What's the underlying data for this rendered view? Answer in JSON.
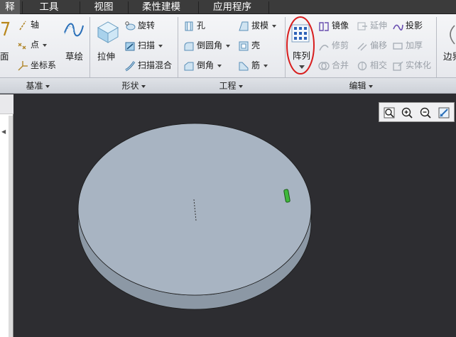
{
  "menu": {
    "tabs": [
      {
        "label": "释",
        "active": true
      },
      {
        "label": "工具",
        "active": false
      },
      {
        "label": "视图",
        "active": false
      },
      {
        "label": "柔性建模",
        "active": false
      },
      {
        "label": "应用程序",
        "active": false
      }
    ]
  },
  "groups": {
    "datum": {
      "label": "基准",
      "axis": "轴",
      "point": "点",
      "csys": "坐标系",
      "plane_partial": "面",
      "sketch": "草绘"
    },
    "shapes": {
      "label": "形状",
      "extrude": "拉伸",
      "revolve": "旋转",
      "sweep": "扫描",
      "swept_blend": "扫描混合"
    },
    "engineering": {
      "label": "工程",
      "hole": "孔",
      "round": "倒圆角",
      "chamfer": "倒角",
      "draft": "拔模",
      "shell": "壳",
      "rib": "筋"
    },
    "editing": {
      "label": "编辑",
      "pattern": "阵列",
      "mirror": "镜像",
      "extend": "延伸",
      "project": "投影",
      "trim": "修剪",
      "offset": "偏移",
      "thicken": "加厚",
      "merge": "合并",
      "intersect": "相交",
      "solidify": "实体化"
    },
    "surfaces": {
      "boundary_blend_partial": "边界"
    }
  },
  "colors": {
    "accent_highlight": "#d81e1e",
    "model_face": "#a7b4c2",
    "model_side": "#8e9aa7",
    "viewport_bg": "#2d2d31"
  },
  "view_toolbar": {
    "buttons": [
      "refit-icon",
      "zoom-in-icon",
      "zoom-out-icon",
      "repaint-icon"
    ]
  }
}
